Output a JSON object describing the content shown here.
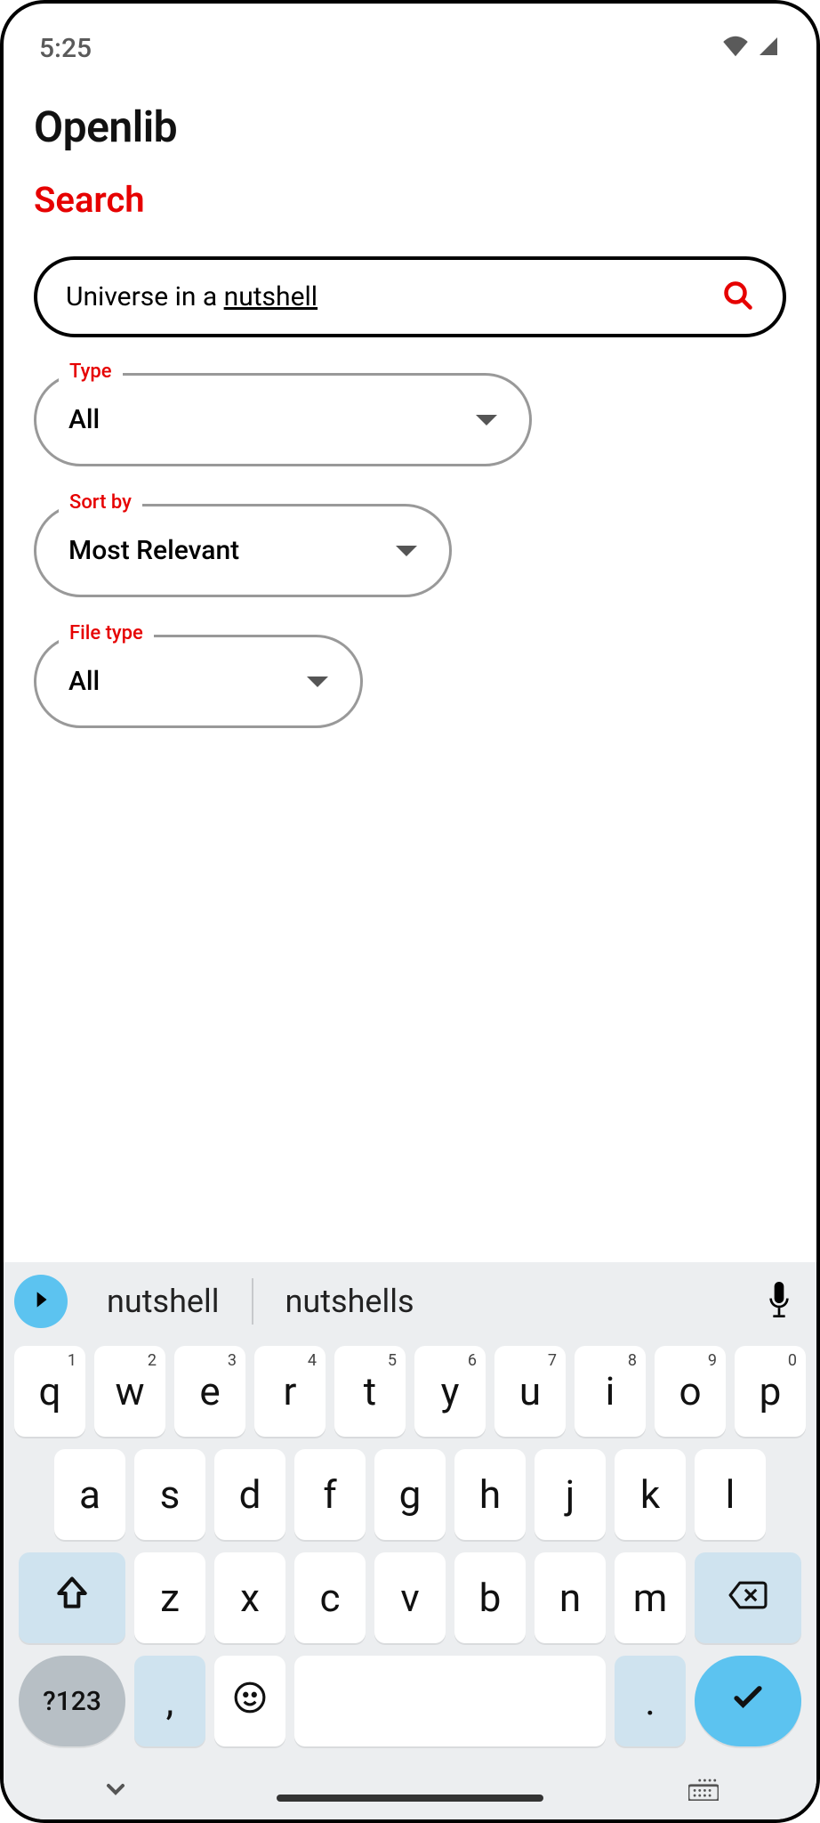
{
  "status": {
    "time": "5:25"
  },
  "app": {
    "title": "Openlib",
    "section": "Search",
    "search_value": "Universe in a nutshell",
    "search_underlined_word": "nutshell"
  },
  "filters": {
    "type": {
      "label": "Type",
      "value": "All"
    },
    "sort_by": {
      "label": "Sort by",
      "value": "Most Relevant"
    },
    "file_type": {
      "label": "File type",
      "value": "All"
    }
  },
  "keyboard": {
    "suggestions": [
      "nutshell",
      "nutshells"
    ],
    "row1": [
      {
        "k": "q",
        "s": "1"
      },
      {
        "k": "w",
        "s": "2"
      },
      {
        "k": "e",
        "s": "3"
      },
      {
        "k": "r",
        "s": "4"
      },
      {
        "k": "t",
        "s": "5"
      },
      {
        "k": "y",
        "s": "6"
      },
      {
        "k": "u",
        "s": "7"
      },
      {
        "k": "i",
        "s": "8"
      },
      {
        "k": "o",
        "s": "9"
      },
      {
        "k": "p",
        "s": "0"
      }
    ],
    "row2": [
      "a",
      "s",
      "d",
      "f",
      "g",
      "h",
      "j",
      "k",
      "l"
    ],
    "row3": [
      "z",
      "x",
      "c",
      "v",
      "b",
      "n",
      "m"
    ],
    "symnum_label": "?123",
    "comma": ",",
    "period": "."
  }
}
